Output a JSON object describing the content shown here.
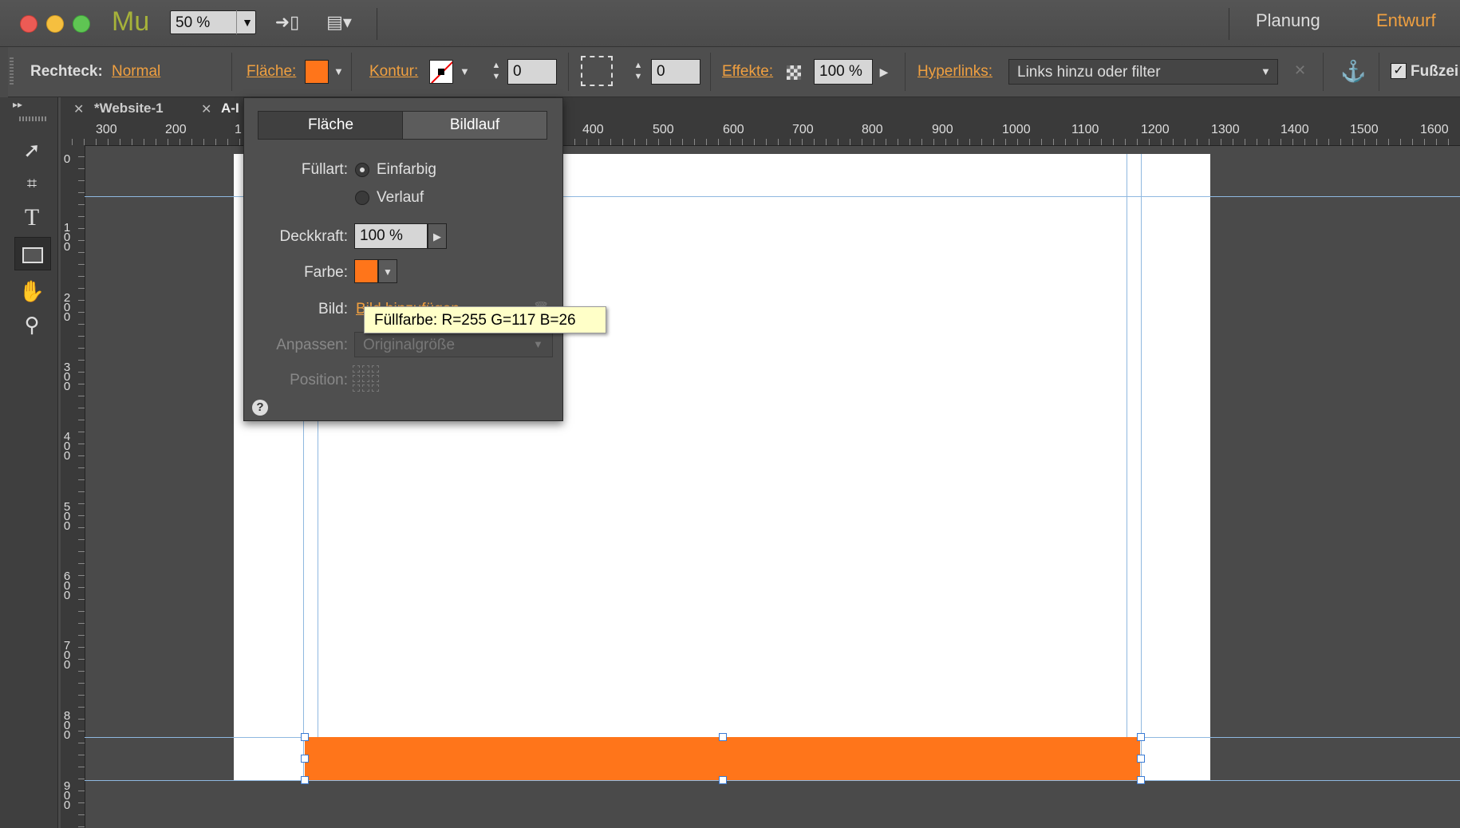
{
  "app": {
    "logo": "Mu",
    "zoom": "50 %",
    "workspaces": [
      "Planung",
      "Entwurf"
    ],
    "active_workspace": "Entwurf"
  },
  "controlbar": {
    "object_type_label": "Rechteck:",
    "object_state": "Normal",
    "fill_label": "Fläche:",
    "fill_color": "#ff751a",
    "stroke_label": "Kontur:",
    "stroke_value": "0",
    "corner_value": "0",
    "effects_label": "Effekte:",
    "opacity_value": "100 %",
    "hyperlinks_label": "Hyperlinks:",
    "hyperlinks_value": "Links hinzu oder filter",
    "footer_label": "Fußzei"
  },
  "tabs": [
    {
      "label": "*Website-1"
    },
    {
      "label": "A-I"
    }
  ],
  "ruler": {
    "h_labels": [
      "300",
      "200",
      "1",
      "400",
      "500",
      "600",
      "700",
      "800",
      "900",
      "1000",
      "1100",
      "1200",
      "1300",
      "1400",
      "1500",
      "1600"
    ],
    "v_labels": [
      "0",
      "100",
      "200",
      "300",
      "400",
      "500",
      "600",
      "700",
      "800",
      "900"
    ]
  },
  "panel": {
    "tab_fill": "Fläche",
    "tab_scroll": "Bildlauf",
    "fill_type_label": "Füllart:",
    "fill_solid": "Einfarbig",
    "fill_gradient": "Verlauf",
    "opacity_label": "Deckkraft:",
    "opacity_value": "100 %",
    "color_label": "Farbe:",
    "color_value": "#ff751a",
    "image_label": "Bild:",
    "image_link": "Bild hinzufügen",
    "fit_label": "Anpassen:",
    "fit_value": "Originalgröße",
    "position_label": "Position:"
  },
  "tooltip": "Füllfarbe: R=255 G=117 B=26",
  "colors": {
    "accent": "#f0a040",
    "shape_fill": "#ff751a",
    "logo": "#a6b23a"
  }
}
